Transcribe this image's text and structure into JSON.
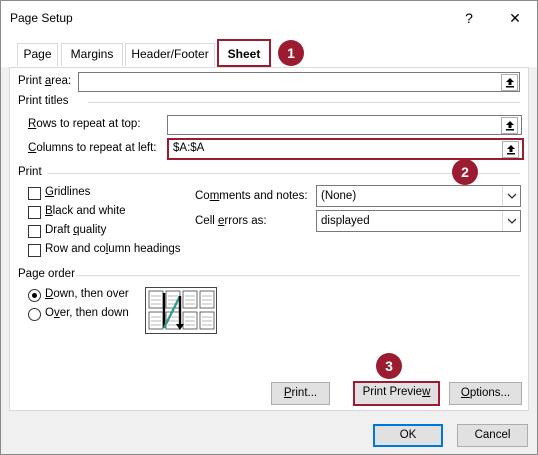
{
  "window": {
    "title": "Page Setup",
    "help_label": "?",
    "close_label": "✕"
  },
  "tabs": [
    {
      "label": "Page"
    },
    {
      "label": "Margins"
    },
    {
      "label": "Header/Footer"
    },
    {
      "label": "Sheet",
      "active": true
    }
  ],
  "print_area": {
    "label_pre": "Print ",
    "label_underlined": "a",
    "label_post": "rea:",
    "value": ""
  },
  "print_titles": {
    "section_label": "Print titles",
    "rows": {
      "label_underlined": "R",
      "label_post": "ows to repeat at top:",
      "value": ""
    },
    "columns": {
      "label_underlined": "C",
      "label_post": "olumns to repeat at left:",
      "value": "$A:$A"
    }
  },
  "print": {
    "section_label": "Print",
    "gridlines": {
      "label_underlined": "G",
      "label_post": "ridlines",
      "checked": false
    },
    "black_white": {
      "label_underlined": "B",
      "label_post": "lack and white",
      "checked": false
    },
    "draft": {
      "label_pre": "Draft ",
      "label_underlined": "q",
      "label_post": "uality",
      "checked": false
    },
    "row_col_headings": {
      "label_pre": "Row and co",
      "label_underlined": "l",
      "label_post": "umn headings",
      "checked": false
    },
    "comments": {
      "label_pre": "Co",
      "label_underlined": "m",
      "label_post": "ments and notes:",
      "value": "(None)"
    },
    "cell_errors": {
      "label_pre": "Cell ",
      "label_underlined": "e",
      "label_post": "rrors as:",
      "value": "displayed"
    }
  },
  "page_order": {
    "section_label": "Page order",
    "down_over": {
      "label_underlined": "D",
      "label_post": "own, then over",
      "selected": true
    },
    "over_down": {
      "label_pre": "O",
      "label_underlined": "v",
      "label_post": "er, then down",
      "selected": false
    }
  },
  "buttons": {
    "print": {
      "label_underlined": "P",
      "label_post": "rint..."
    },
    "print_preview": {
      "label_pre": "Print Previe",
      "label_underlined": "w",
      "label_post": ""
    },
    "options": {
      "label_underlined": "O",
      "label_post": "ptions..."
    },
    "ok": "OK",
    "cancel": "Cancel"
  },
  "callouts": [
    "1",
    "2",
    "3"
  ],
  "colors": {
    "highlight": "#9b1c31",
    "focus_blue": "#0078d7",
    "page_order_arrow": "#2e9e8f"
  },
  "icons": [
    "collapse-dialog-icon",
    "dropdown-arrow-icon",
    "page-order-icon"
  ]
}
